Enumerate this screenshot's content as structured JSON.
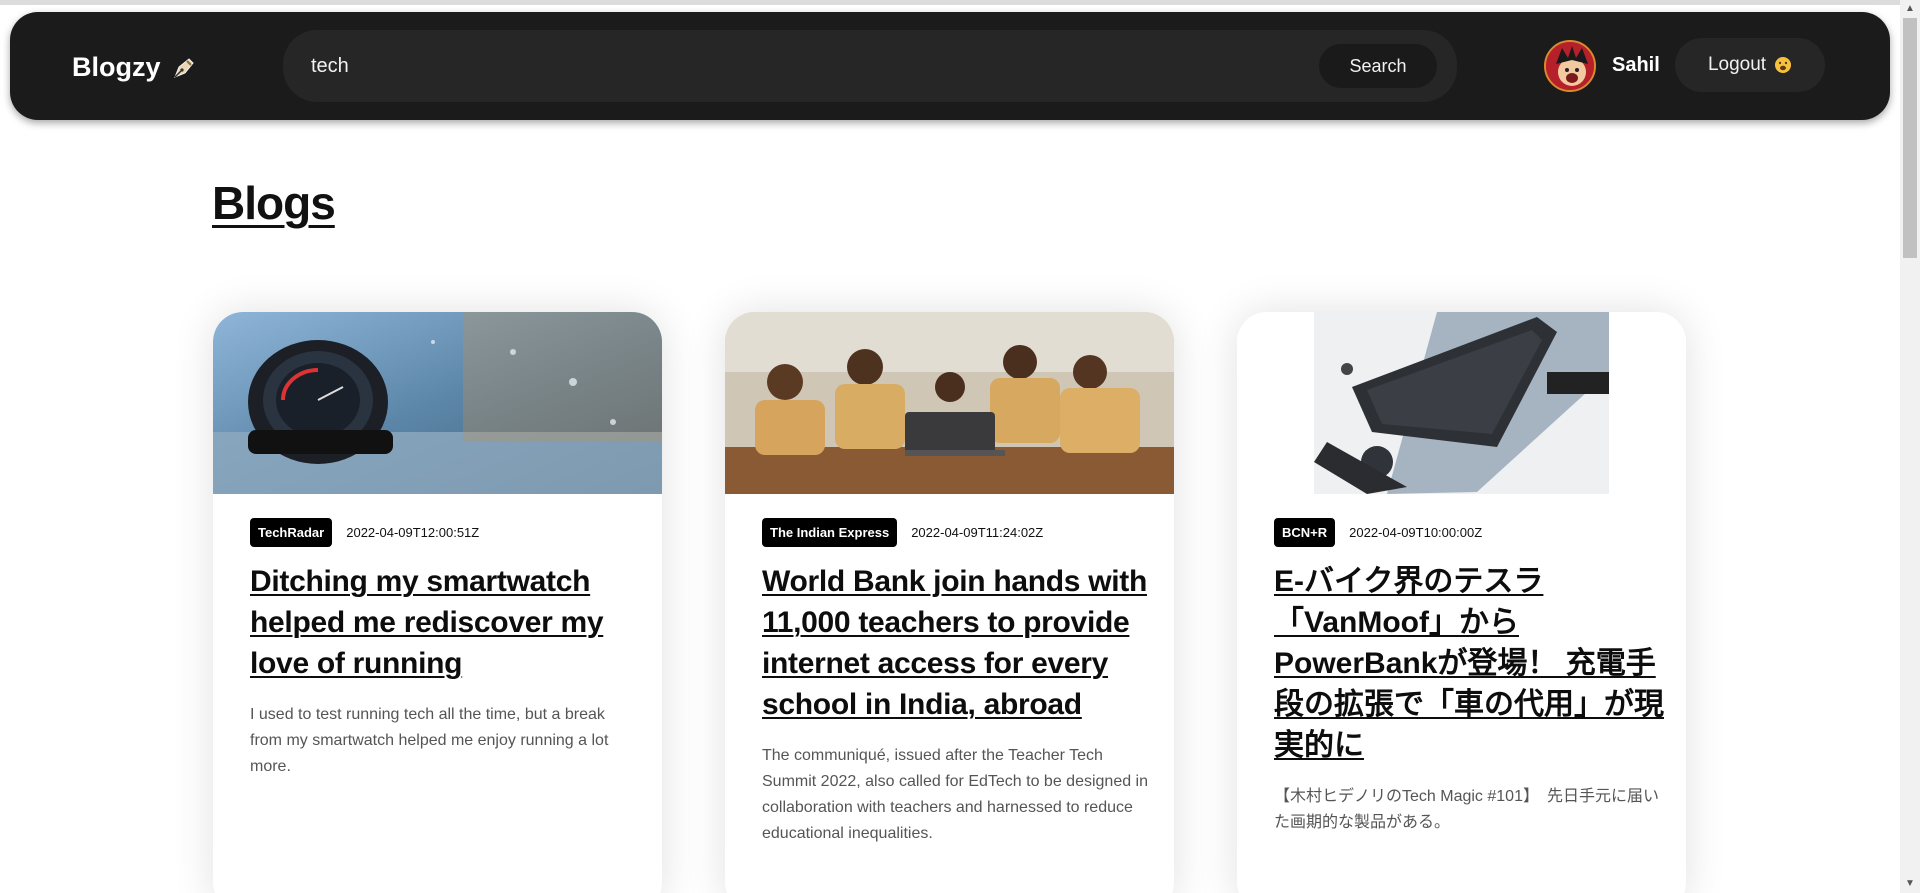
{
  "header": {
    "brand": "Blogzy",
    "brand_icon": "pen-nib-icon",
    "search_value": "tech",
    "search_button": "Search",
    "username": "Sahil",
    "logout_label": "Logout",
    "logout_icon": "zipper-mouth-emoji-icon"
  },
  "main": {
    "title": "Blogs"
  },
  "cards": [
    {
      "source": "TechRadar",
      "date": "2022-04-09T12:00:51Z",
      "title": "Ditching my smartwatch helped me rediscover my love of running",
      "description": "I used to test running tech all the time, but a break from my smartwatch helped me enjoy running a lot more.",
      "image": "smartwatch-photo"
    },
    {
      "source": "The Indian Express",
      "date": "2022-04-09T11:24:02Z",
      "title": "World Bank join hands with 11,000 teachers to provide internet access for every school in India, abroad",
      "description": "The communiqué, issued after the Teacher Tech Summit 2022, also called for EdTech to be designed in collaboration with teachers and harnessed to reduce educational inequalities.",
      "image": "students-laptop-photo"
    },
    {
      "source": "BCN+R",
      "date": "2022-04-09T10:00:00Z",
      "title": "E-バイク界のテスラ「VanMoof」から PowerBankが登場！ 充電手段の拡張で「車の代用」が現実的に",
      "description": "【木村ヒデノリのTech Magic #101】　先日手元に届いた画期的な製品がある。",
      "image": "ebike-powerbank-photo"
    }
  ],
  "colors": {
    "navbar": "#1b1b1b",
    "search_bg": "#262626",
    "badge_bg": "#000000",
    "page_bg": "#ffffff"
  }
}
